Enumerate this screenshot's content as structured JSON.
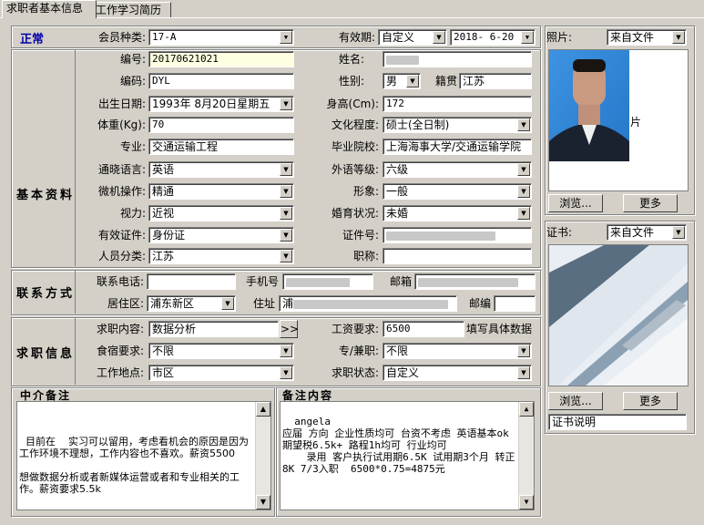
{
  "tabs": [
    {
      "label": "求职者基本信息"
    },
    {
      "label": "工作学习简历"
    }
  ],
  "status": "正常",
  "top": {
    "member_type_label": "会员种类:",
    "member_type": "17-A",
    "validity_label": "有效期:",
    "validity_mode": "自定义",
    "validity_date": "2018- 6-20"
  },
  "basic": {
    "title": "基本资料",
    "number_label": "编号:",
    "number": "20170621021",
    "name_label": "姓名:",
    "code_label": "编码:",
    "code": "DYL",
    "gender_label": "性别:",
    "gender": "男",
    "native_label": "籍贯",
    "native": "江苏",
    "birth_label": "出生日期:",
    "birth": "1993年 8月20日星期五",
    "height_label": "身高(Cm):",
    "height": "172",
    "weight_label": "体重(Kg):",
    "weight": "70",
    "edu_label": "文化程度:",
    "edu": "硕士(全日制)",
    "major_label": "专业:",
    "major": "交通运输工程",
    "school_label": "毕业院校:",
    "school": "上海海事大学/交通运输学院",
    "lang_label": "通晓语言:",
    "lang": "英语",
    "lang_level_label": "外语等级:",
    "lang_level": "六级",
    "pc_label": "微机操作:",
    "pc": "精通",
    "appearance_label": "形象:",
    "appearance": "一般",
    "vision_label": "视力:",
    "vision": "近视",
    "marital_label": "婚育状况:",
    "marital": "未婚",
    "cert_label": "有效证件:",
    "cert": "身份证",
    "cert_no_label": "证件号:",
    "category_label": "人员分类:",
    "category": "江苏",
    "job_title_label": "职称:"
  },
  "contact": {
    "title": "联系方式",
    "phone_label": "联系电话:",
    "mobile_label": "手机号",
    "email_label": "邮箱",
    "district_label": "居住区:",
    "district": "浦东新区",
    "address_label": "住址",
    "address_prefix": "浦",
    "zip_label": "邮编"
  },
  "job": {
    "title": "求职信息",
    "content_label": "求职内容:",
    "content": "数据分析",
    "more_btn": ">>",
    "salary_label": "工资要求:",
    "salary": "6500",
    "salary_note": "填写具体数据",
    "board_label": "食宿要求:",
    "board": "不限",
    "type_label": "专/兼职:",
    "type": "不限",
    "location_label": "工作地点:",
    "location": "市区",
    "state_label": "求职状态:",
    "state": "自定义"
  },
  "agent_note": {
    "title": "中介备注",
    "text": "目前在    实习可以留用，考虑看机会的原因是因为工作环境不理想，工作内容也不喜欢。薪资5500\n\n想做数据分析或者新媒体运营或者和专业相关的工作。薪资要求5.5k"
  },
  "remark": {
    "title": "备注内容",
    "text": "angela\n应届 方向 企业性质均可 台资不考虑 英语基本ok 期望税6.5k+ 路程1h均可 行业均可\n    录用 客户执行试用期6.5K 试用期3个月 转正8K 7/3入职  6500*0.75=4875元"
  },
  "photo": {
    "label": "照片:",
    "source": "来自文件",
    "browse": "浏览...",
    "more": "更多",
    "caption": "片"
  },
  "certificate": {
    "label": "证书:",
    "source": "来自文件",
    "browse": "浏览...",
    "more": "更多",
    "desc_label": "证书说明"
  }
}
